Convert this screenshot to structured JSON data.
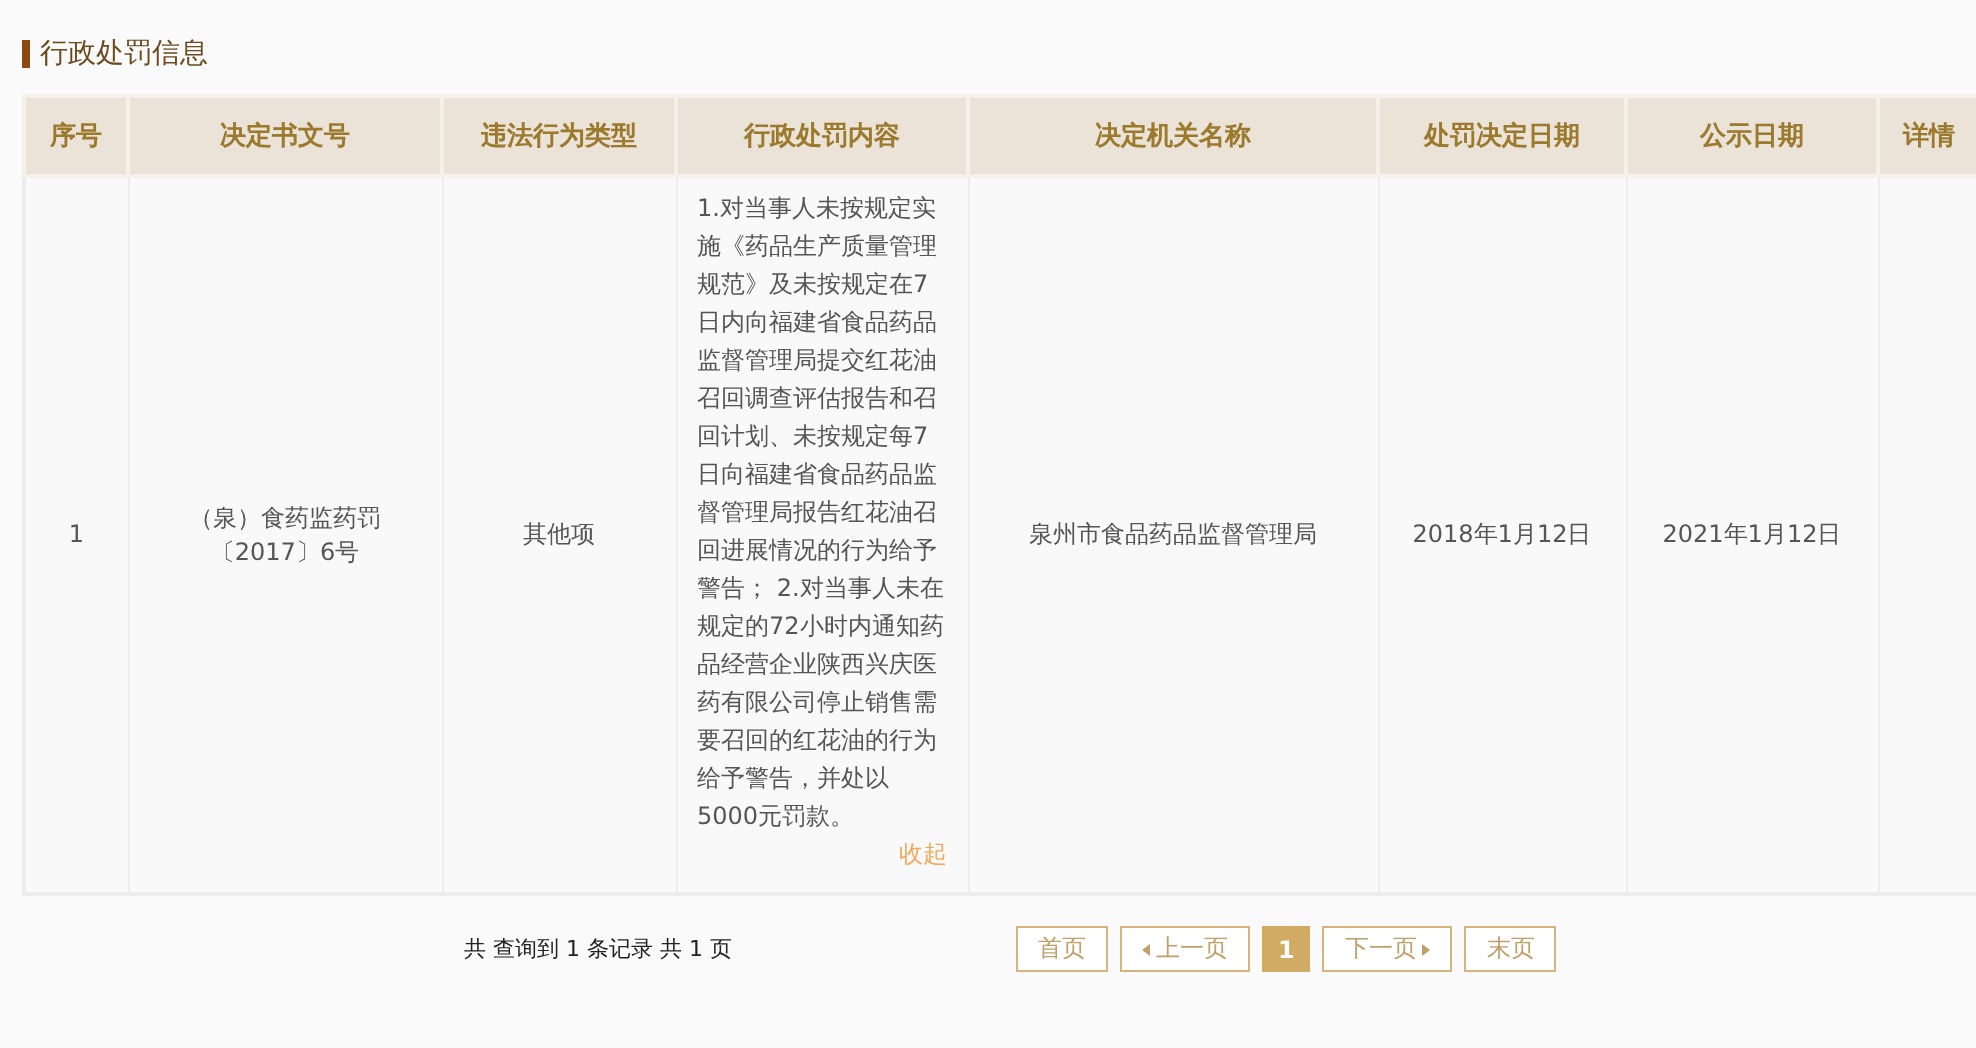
{
  "section_title": "行政处罚信息",
  "table": {
    "columns": [
      "序号",
      "决定书文号",
      "违法行为类型",
      "行政处罚内容",
      "决定机关名称",
      "处罚决定日期",
      "公示日期",
      "详情"
    ],
    "rows": [
      {
        "cells": [
          "1",
          "（泉）食药监药罚〔2017〕6号",
          "其他项",
          "1.对当事人未按规定实施《药品生产质量管理规范》及未按规定在7日内向福建省食品药品监督管理局提交红花油召回调查评估报告和召回计划、未按规定每7日向福建省食品药品监督管理局报告红花油召回进展情况的行为给予警告； 2.对当事人未在规定的72小时内通知药品经营企业陕西兴庆医药有限公司停止销售需要召回的红花油的行为给予警告，并处以5000元罚款。",
          "泉州市食品药品监督管理局",
          "2018年1月12日",
          "2021年1月12日",
          ""
        ],
        "collapse_link": "收起"
      }
    ]
  },
  "pagination": {
    "summary": "共 查询到 1 条记录 共 1 页",
    "items": [
      {
        "kind": "text",
        "label": "首页",
        "selected": false
      },
      {
        "kind": "prev",
        "label": "上一页",
        "selected": false
      },
      {
        "kind": "page",
        "label": "1",
        "selected": true
      },
      {
        "kind": "next",
        "label": "下一页",
        "selected": false
      },
      {
        "kind": "text",
        "label": "末页",
        "selected": false
      }
    ]
  }
}
